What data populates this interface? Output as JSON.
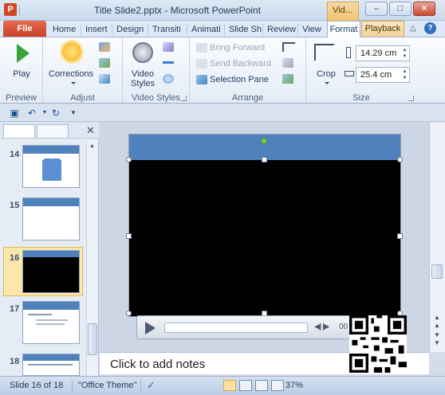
{
  "window": {
    "app_icon_letter": "P",
    "title": "Title Slide2.pptx - Microsoft PowerPoint",
    "context_tab_title": "Vid..."
  },
  "tabs": {
    "file": "File",
    "items": [
      "Home",
      "Insert",
      "Design",
      "Transiti",
      "Animati",
      "Slide Sh",
      "Review",
      "View"
    ],
    "active": "Format",
    "playback": "Playback"
  },
  "ribbon": {
    "preview": {
      "play_label": "Play",
      "group_label": "Preview"
    },
    "adjust": {
      "corrections_label": "Corrections",
      "group_label": "Adjust"
    },
    "video_styles": {
      "button_label_1": "Video",
      "button_label_2": "Styles",
      "group_label": "Video Styles"
    },
    "arrange": {
      "bring_forward": "Bring Forward",
      "send_backward": "Send Backward",
      "selection_pane": "Selection Pane",
      "group_label": "Arrange"
    },
    "size": {
      "crop_label": "Crop",
      "height_value": "14.29 cm",
      "width_value": "25.4 cm",
      "group_label": "Size"
    }
  },
  "slides": [
    {
      "number": "14"
    },
    {
      "number": "15"
    },
    {
      "number": "16"
    },
    {
      "number": "17"
    },
    {
      "number": "18"
    }
  ],
  "selected_slide": "16",
  "notes_placeholder": "Click to add notes",
  "status": {
    "slide_info": "Slide 16 of 18",
    "theme": "\"Office Theme\"",
    "zoom": "37%"
  },
  "colors": {
    "slide_banner": "#4f81bd",
    "file_tab": "#c9402a",
    "selection": "#fbe7a9"
  }
}
